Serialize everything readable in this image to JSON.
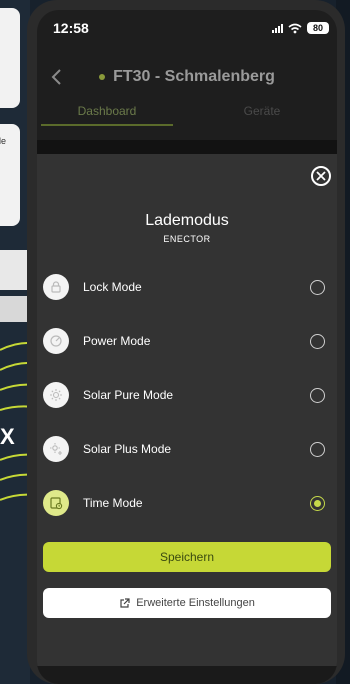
{
  "statusbar": {
    "time": "12:58",
    "battery": "80"
  },
  "header": {
    "title": "FT30 - Schmalenberg"
  },
  "tabs": [
    {
      "label": "Dashboard"
    },
    {
      "label": "Geräte"
    }
  ],
  "background": {
    "card_text": "de",
    "x_mark": "X"
  },
  "modal": {
    "title": "Lademodus",
    "subtitle": "ENECTOR",
    "modes": [
      {
        "label": "Lock Mode",
        "icon": "lock-icon",
        "selected": false
      },
      {
        "label": "Power Mode",
        "icon": "gauge-icon",
        "selected": false
      },
      {
        "label": "Solar Pure Mode",
        "icon": "sun-icon",
        "selected": false
      },
      {
        "label": "Solar Plus Mode",
        "icon": "sun-plus-icon",
        "selected": false
      },
      {
        "label": "Time Mode",
        "icon": "clock-icon",
        "selected": true
      }
    ],
    "save_label": "Speichern",
    "advanced_label": "Erweiterte Einstellungen"
  },
  "colors": {
    "accent": "#c6d836",
    "modal_bg": "#333333"
  }
}
